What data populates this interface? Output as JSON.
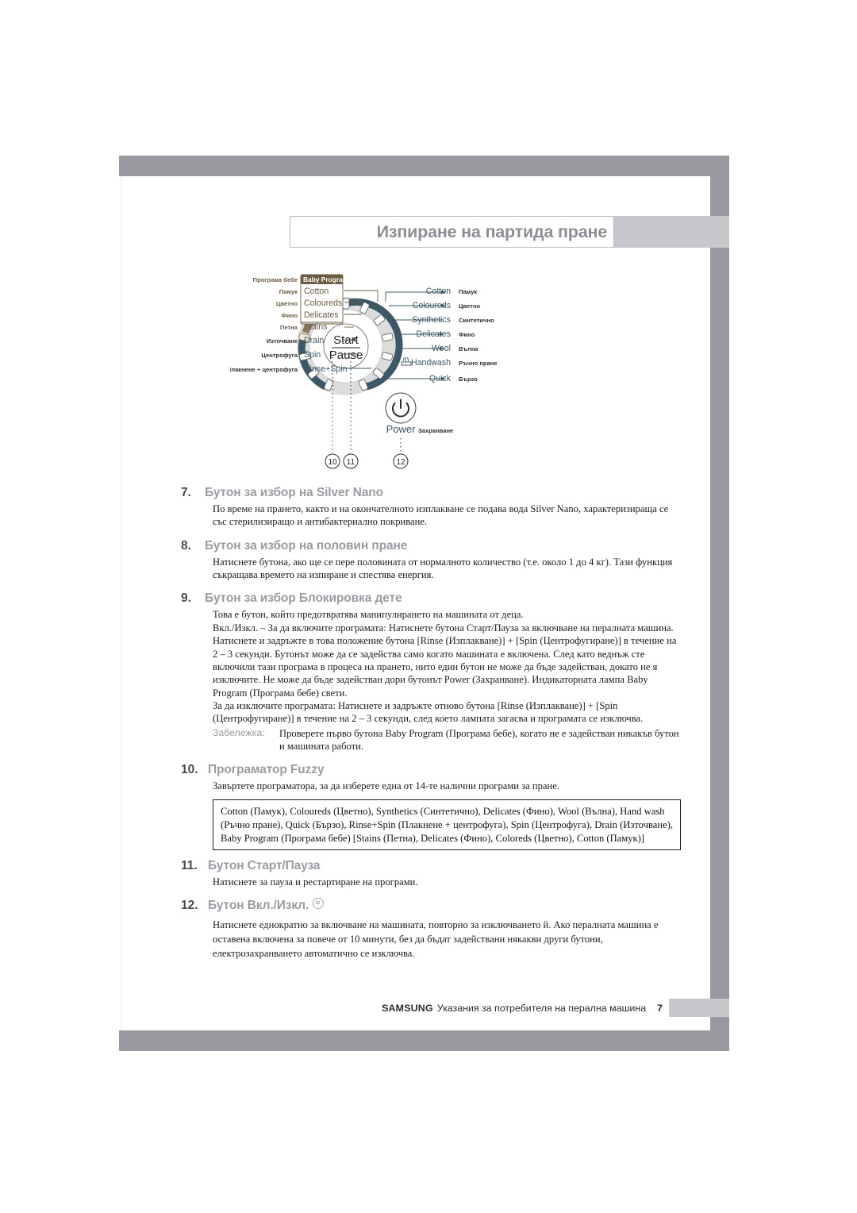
{
  "header": {
    "title": "Изпиране на партида пране"
  },
  "diagram": {
    "baby_program_label": "Baby Program",
    "start_label": "Start",
    "pause_label": "Pause",
    "power_label": "Power",
    "power_label_bg": "Захранване",
    "left_column": [
      {
        "bg": "Програма бебе",
        "en": "Baby Program"
      },
      {
        "bg": "Памук",
        "en": "Cotton"
      },
      {
        "bg": "Цветно",
        "en": "Coloureds"
      },
      {
        "bg": "Фино",
        "en": "Delicates"
      },
      {
        "bg": "Петна",
        "en": "Stains"
      },
      {
        "bg": "Източване",
        "en": "Drain"
      },
      {
        "bg": "Центрофуга",
        "en": "Spin"
      },
      {
        "bg": "Плакнене + центрофуга",
        "en": "Rinse+Spin"
      }
    ],
    "right_column": [
      {
        "en": "Cotton",
        "bg": "Памук"
      },
      {
        "en": "Coloureds",
        "bg": "Цветно"
      },
      {
        "en": "Synthetics",
        "bg": "Синтетично"
      },
      {
        "en": "Delicates",
        "bg": "Фино"
      },
      {
        "en": "Wool",
        "bg": "Вълна"
      },
      {
        "en": "Handwash",
        "bg": "Ръчно пране"
      },
      {
        "en": "Quick",
        "bg": "Бързо"
      }
    ],
    "callouts": [
      "10",
      "11",
      "12"
    ]
  },
  "sections": [
    {
      "num": "7.",
      "title": "Бутон за избор на Silver Nano",
      "body": "По време на прането, както и на окончателното изплакване се подава вода Silver Nano, характеризираща се със стерилизиращо и антибактериално покриване."
    },
    {
      "num": "8.",
      "title": "Бутон за избор на половин пране",
      "body": "Натиснете бутона, ако ще се пере половината от нормалното количество (т.е. около 1 до 4 кг). Тази функция съкращава времето на изпиране и спестява енергия."
    },
    {
      "num": "9.",
      "title": "Бутон за избор Блокировка дете",
      "body_lines": [
        "Това е бутон, който предотвратява манипулирането на машината от деца.",
        "Вкл./Изкл. – За да включите програмата: Натиснете бутона Старт/Пауза за включване на пералната машина. Натиснете и задръжте в това положение бутона [Rinse (Изплакване)] + [Spin (Центрофугиране)] в течение на 2 – 3 секунди. Бутонът може да се задейства само когато машината е включена. След като веднъж сте включили тази програма в процеса на прането, нито един бутон не може да бъде задействан, докато не я изключите. Не може да бъде задействан дори бутонът Power (Захранване). Индикаторната лампа Baby Program (Програма бебе) свети.",
        "За да изключите програмата: Натиснете и задръжте отново бутона [Rinse (Изплакване)] + [Spin (Центрофугиране)] в течение на 2 – 3 секунди, след което лампата загасва и програмата се изключва."
      ],
      "note_label": "Забележка:",
      "note_text": "Проверете първо бутона Baby Program (Програма бебе), когато не е задействан никакъв бутон и машината работи."
    },
    {
      "num": "10.",
      "title": "Програматор Fuzzy",
      "body": "Завъртете програматора, за да изберете една от 14-те налични програми за пране.",
      "box_text": "Cotton (Памук), Coloureds (Цветно), Synthetics (Синтетично), Delicates (Фино), Wool (Вълна), Hand wash (Ръчно пране), Quick (Бързо), Rinse+Spin (Плакнене + центрофуга), Spin (Центрофуга), Drain (Източване), Baby Program (Програма бебе) [Stains (Петна), Delicates (Фино), Coloreds (Цветно), Cotton (Памук)]"
    },
    {
      "num": "11.",
      "title": "Бутон Старт/Пауза",
      "body": "Натиснете за пауза и рестартиране на програми."
    },
    {
      "num": "12.",
      "title": "Бутон Вкл./Изкл.",
      "body": "Натиснете еднократно за включване на машината, повторно за изключването й. Ако пералната машина е оставена включена за повече от 10 минути, без да бъдат задействани някакви други бутони, електрозахранването автоматично се изключва."
    }
  ],
  "footer": {
    "brand": "SAMSUNG",
    "text": "Указания за потребителя на перална машина",
    "page": "7"
  },
  "colors": {
    "bar_dark": "#989a9f",
    "bar_light": "#c6c8cc",
    "heading": "#9a9ca3",
    "baby_brown": "#8a7356",
    "dial_teal": "#3c5866"
  }
}
